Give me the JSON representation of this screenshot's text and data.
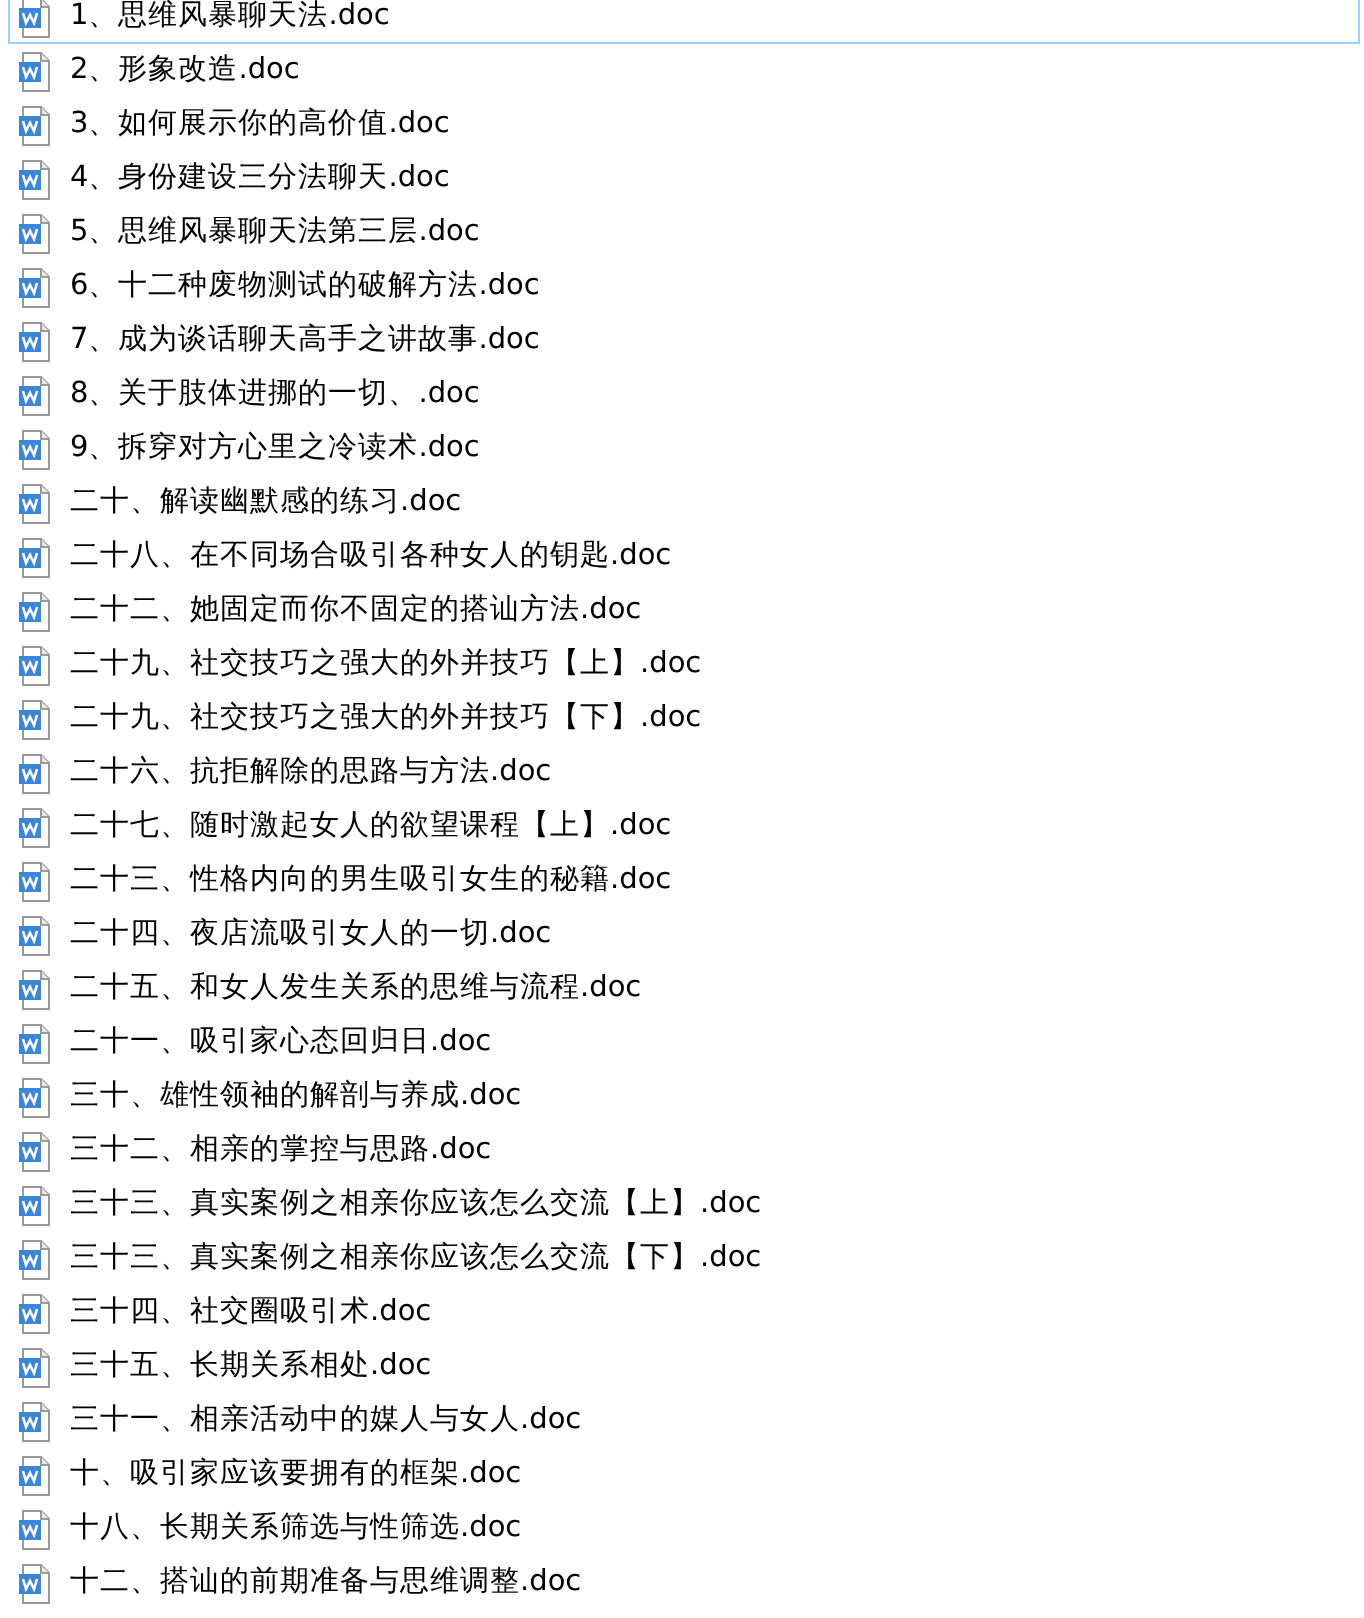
{
  "files": [
    {
      "name": "1、思维风暴聊天法.doc",
      "focused": true
    },
    {
      "name": "2、形象改造.doc",
      "focused": false
    },
    {
      "name": "3、如何展示你的高价值.doc",
      "focused": false
    },
    {
      "name": "4、身份建设三分法聊天.doc",
      "focused": false
    },
    {
      "name": "5、思维风暴聊天法第三层.doc",
      "focused": false
    },
    {
      "name": "6、十二种废物测试的破解方法.doc",
      "focused": false
    },
    {
      "name": "7、成为谈话聊天高手之讲故事.doc",
      "focused": false
    },
    {
      "name": "8、关于肢体进挪的一切、.doc",
      "focused": false
    },
    {
      "name": "9、拆穿对方心里之冷读术.doc",
      "focused": false
    },
    {
      "name": "二十、解读幽默感的练习.doc",
      "focused": false
    },
    {
      "name": "二十八、在不同场合吸引各种女人的钥匙.doc",
      "focused": false
    },
    {
      "name": "二十二、她固定而你不固定的搭讪方法.doc",
      "focused": false
    },
    {
      "name": "二十九、社交技巧之强大的外并技巧【上】.doc",
      "focused": false
    },
    {
      "name": "二十九、社交技巧之强大的外并技巧【下】.doc",
      "focused": false
    },
    {
      "name": "二十六、抗拒解除的思路与方法.doc",
      "focused": false
    },
    {
      "name": "二十七、随时激起女人的欲望课程【上】.doc",
      "focused": false
    },
    {
      "name": "二十三、性格内向的男生吸引女生的秘籍.doc",
      "focused": false
    },
    {
      "name": "二十四、夜店流吸引女人的一切.doc",
      "focused": false
    },
    {
      "name": "二十五、和女人发生关系的思维与流程.doc",
      "focused": false
    },
    {
      "name": "二十一、吸引家心态回归日.doc",
      "focused": false
    },
    {
      "name": "三十、雄性领袖的解剖与养成.doc",
      "focused": false
    },
    {
      "name": "三十二、相亲的掌控与思路.doc",
      "focused": false
    },
    {
      "name": "三十三、真实案例之相亲你应该怎么交流【上】.doc",
      "focused": false
    },
    {
      "name": "三十三、真实案例之相亲你应该怎么交流【下】.doc",
      "focused": false
    },
    {
      "name": "三十四、社交圈吸引术.doc",
      "focused": false
    },
    {
      "name": "三十五、长期关系相处.doc",
      "focused": false
    },
    {
      "name": "三十一、相亲活动中的媒人与女人.doc",
      "focused": false
    },
    {
      "name": "十、吸引家应该要拥有的框架.doc",
      "focused": false
    },
    {
      "name": "十八、长期关系筛选与性筛选.doc",
      "focused": false
    },
    {
      "name": "十二、搭讪的前期准备与思维调整.doc",
      "focused": false
    }
  ]
}
